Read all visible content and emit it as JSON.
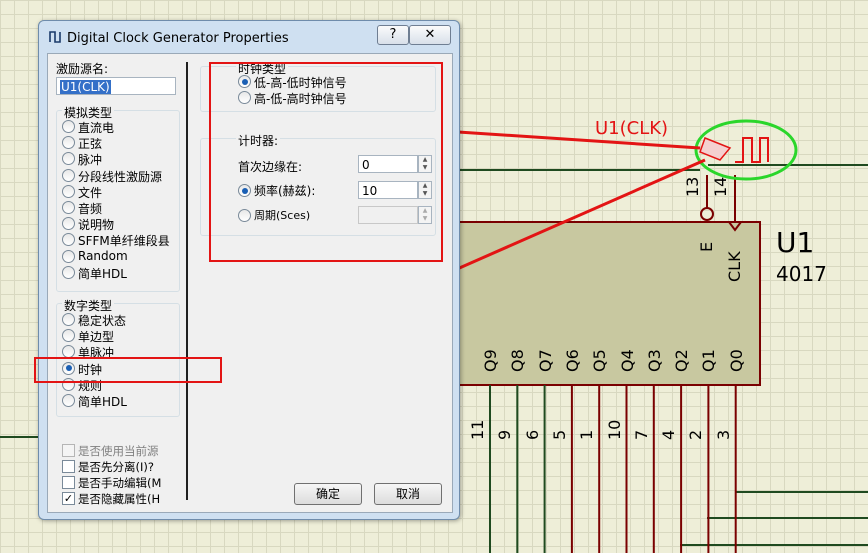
{
  "dialog": {
    "title": "Digital Clock Generator Properties",
    "help_button": "?",
    "close_button": "✕",
    "source_name_label": "激励源名:",
    "source_name_value": "U1(CLK)",
    "analog_types_label": "模拟类型",
    "analog_types": [
      "直流电",
      "正弦",
      "脉冲",
      "分段线性激励源",
      "文件",
      "音频",
      "说明物",
      "SFFM单纤维段县",
      "Random",
      "简单HDL"
    ],
    "digital_types_label": "数字类型",
    "digital_types": [
      "稳定状态",
      "单边型",
      "单脉冲",
      "时钟",
      "规则",
      "简单HDL"
    ],
    "digital_selected": "时钟",
    "checkboxes": [
      {
        "label": "是否使用当前源",
        "checked": false,
        "disabled": true
      },
      {
        "label": "是否先分离(I)?",
        "checked": false,
        "disabled": false
      },
      {
        "label": "是否手动编辑(M",
        "checked": false,
        "disabled": false
      },
      {
        "label": "是否隐藏属性(H",
        "checked": true,
        "disabled": false
      }
    ],
    "clock_type_label": "时钟类型",
    "clock_types": [
      "低-高-低时钟信号",
      "高-低-高时钟信号"
    ],
    "clock_type_selected": "低-高-低时钟信号",
    "timer_label": "计时器:",
    "first_edge_label": "首次边缘在:",
    "first_edge_value": "0",
    "frequency_label": "频率(赫兹):",
    "frequency_value": "10",
    "period_label": "周期(Sces)",
    "period_value": "",
    "timer_selected": "频率(赫兹):",
    "ok_button": "确定",
    "cancel_button": "取消"
  },
  "schematic": {
    "generator_label": "U1(CLK)",
    "chip_ref": "U1",
    "chip_part": "4017",
    "pin_e": "E",
    "pin_clk": "CLK",
    "pin_num_e": "13",
    "pin_num_clk": "14",
    "outputs": [
      "Q9",
      "Q8",
      "Q7",
      "Q6",
      "Q5",
      "Q4",
      "Q3",
      "Q2",
      "Q1",
      "Q0"
    ],
    "output_pins": [
      "11",
      "9",
      "6",
      "5",
      "1",
      "10",
      "7",
      "4",
      "2",
      "3"
    ],
    "annotation_color": "#e31414",
    "highlight_color": "#2bd62b",
    "chip_fill": "#c8c8a0"
  }
}
